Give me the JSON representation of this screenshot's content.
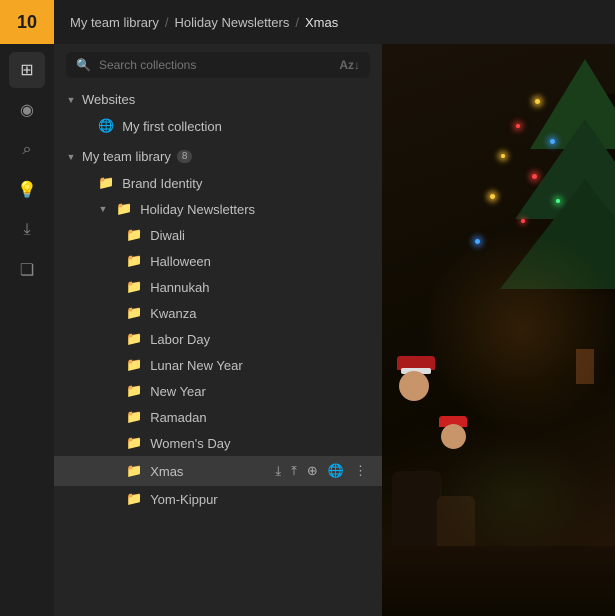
{
  "header": {
    "logo": "10",
    "breadcrumb": [
      {
        "label": "My team library",
        "current": false
      },
      {
        "label": "Holiday Newsletters",
        "current": false
      },
      {
        "label": "Xmas",
        "current": true
      }
    ],
    "breadcrumb_separator": "/"
  },
  "search": {
    "placeholder": "Search collections"
  },
  "sidebar_icons": [
    {
      "name": "collections-icon",
      "symbol": "⊞",
      "active": true
    },
    {
      "name": "brand-icon",
      "symbol": "◉",
      "active": false
    },
    {
      "name": "search-icon",
      "symbol": "⌕",
      "active": false
    },
    {
      "name": "ideas-icon",
      "symbol": "💡",
      "active": false
    },
    {
      "name": "download-icon",
      "symbol": "⤓",
      "active": false
    },
    {
      "name": "layers-icon",
      "symbol": "❏",
      "active": false
    }
  ],
  "tree": {
    "sections": [
      {
        "id": "websites",
        "label": "Websites",
        "expanded": true,
        "items": [
          {
            "id": "first-collection",
            "label": "My first collection",
            "icon": "globe",
            "indent": 2
          }
        ]
      },
      {
        "id": "my-team-library",
        "label": "My team library",
        "badge": "8",
        "expanded": true,
        "items": [
          {
            "id": "brand-identity",
            "label": "Brand Identity",
            "icon": "folder",
            "indent": 2
          },
          {
            "id": "holiday-newsletters",
            "label": "Holiday Newsletters",
            "icon": "folder",
            "indent": 2,
            "expanded": true
          },
          {
            "id": "diwali",
            "label": "Diwali",
            "icon": "folder",
            "indent": 3
          },
          {
            "id": "halloween",
            "label": "Halloween",
            "icon": "folder",
            "indent": 3
          },
          {
            "id": "hannukah",
            "label": "Hannukah",
            "icon": "folder",
            "indent": 3
          },
          {
            "id": "kwanza",
            "label": "Kwanza",
            "icon": "folder",
            "indent": 3
          },
          {
            "id": "labor-day",
            "label": "Labor Day",
            "icon": "folder",
            "indent": 3
          },
          {
            "id": "lunar-new-year",
            "label": "Lunar New Year",
            "icon": "folder",
            "indent": 3
          },
          {
            "id": "new-year",
            "label": "New Year",
            "icon": "folder",
            "indent": 3
          },
          {
            "id": "ramadan",
            "label": "Ramadan",
            "icon": "folder",
            "indent": 3
          },
          {
            "id": "womens-day",
            "label": "Women's Day",
            "icon": "folder",
            "indent": 3
          },
          {
            "id": "xmas",
            "label": "Xmas",
            "icon": "folder-yellow",
            "indent": 3,
            "selected": true,
            "actions": [
              "download",
              "upload",
              "add",
              "globe",
              "more"
            ]
          },
          {
            "id": "yom-kippur",
            "label": "Yom-Kippur",
            "icon": "folder",
            "indent": 3
          }
        ]
      }
    ]
  }
}
